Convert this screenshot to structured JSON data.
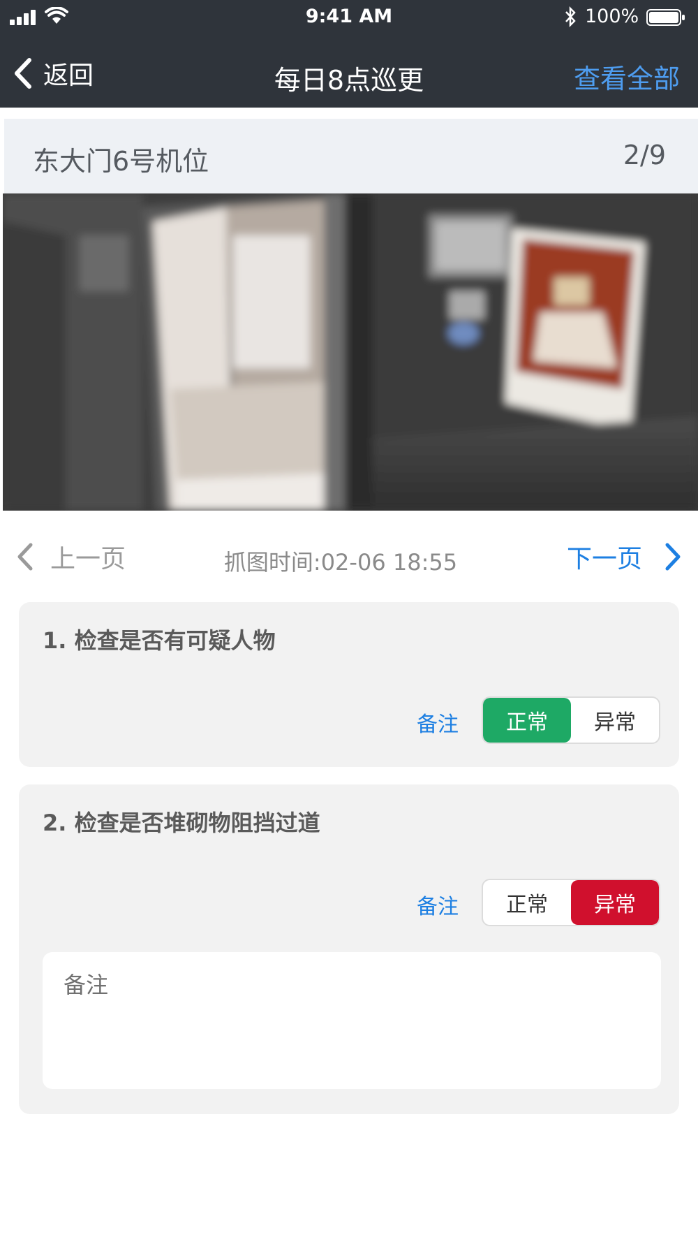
{
  "status_bar": {
    "time": "9:41 AM",
    "battery_percent": "100%",
    "icons": [
      "signal-icon",
      "wifi-icon",
      "bluetooth-icon",
      "battery-icon"
    ]
  },
  "nav": {
    "back_label": "返回",
    "title": "每日8点巡更",
    "view_all_label": "查看全部",
    "colors": {
      "bar": "#2f343b",
      "link": "#4e9df0"
    }
  },
  "camera": {
    "name": "东大门6号机位",
    "counter": "2/9"
  },
  "pager": {
    "prev_label": "上一页",
    "capture_time": "抓图时间:02-06 18:55",
    "next_label": "下一页",
    "colors": {
      "next": "#1d7fe2",
      "prev": "#9a9a9a"
    }
  },
  "checklist": [
    {
      "question": "1. 检查是否有可疑人物",
      "note_label": "备注",
      "normal_label": "正常",
      "abnormal_label": "异常",
      "selected": "normal"
    },
    {
      "question": "2. 检查是否堆砌物阻挡过道",
      "note_label": "备注",
      "normal_label": "正常",
      "abnormal_label": "异常",
      "selected": "abnormal",
      "remark_placeholder": "备注"
    }
  ],
  "colors": {
    "normal_active": "#1ea965",
    "abnormal_active": "#d0102d"
  }
}
